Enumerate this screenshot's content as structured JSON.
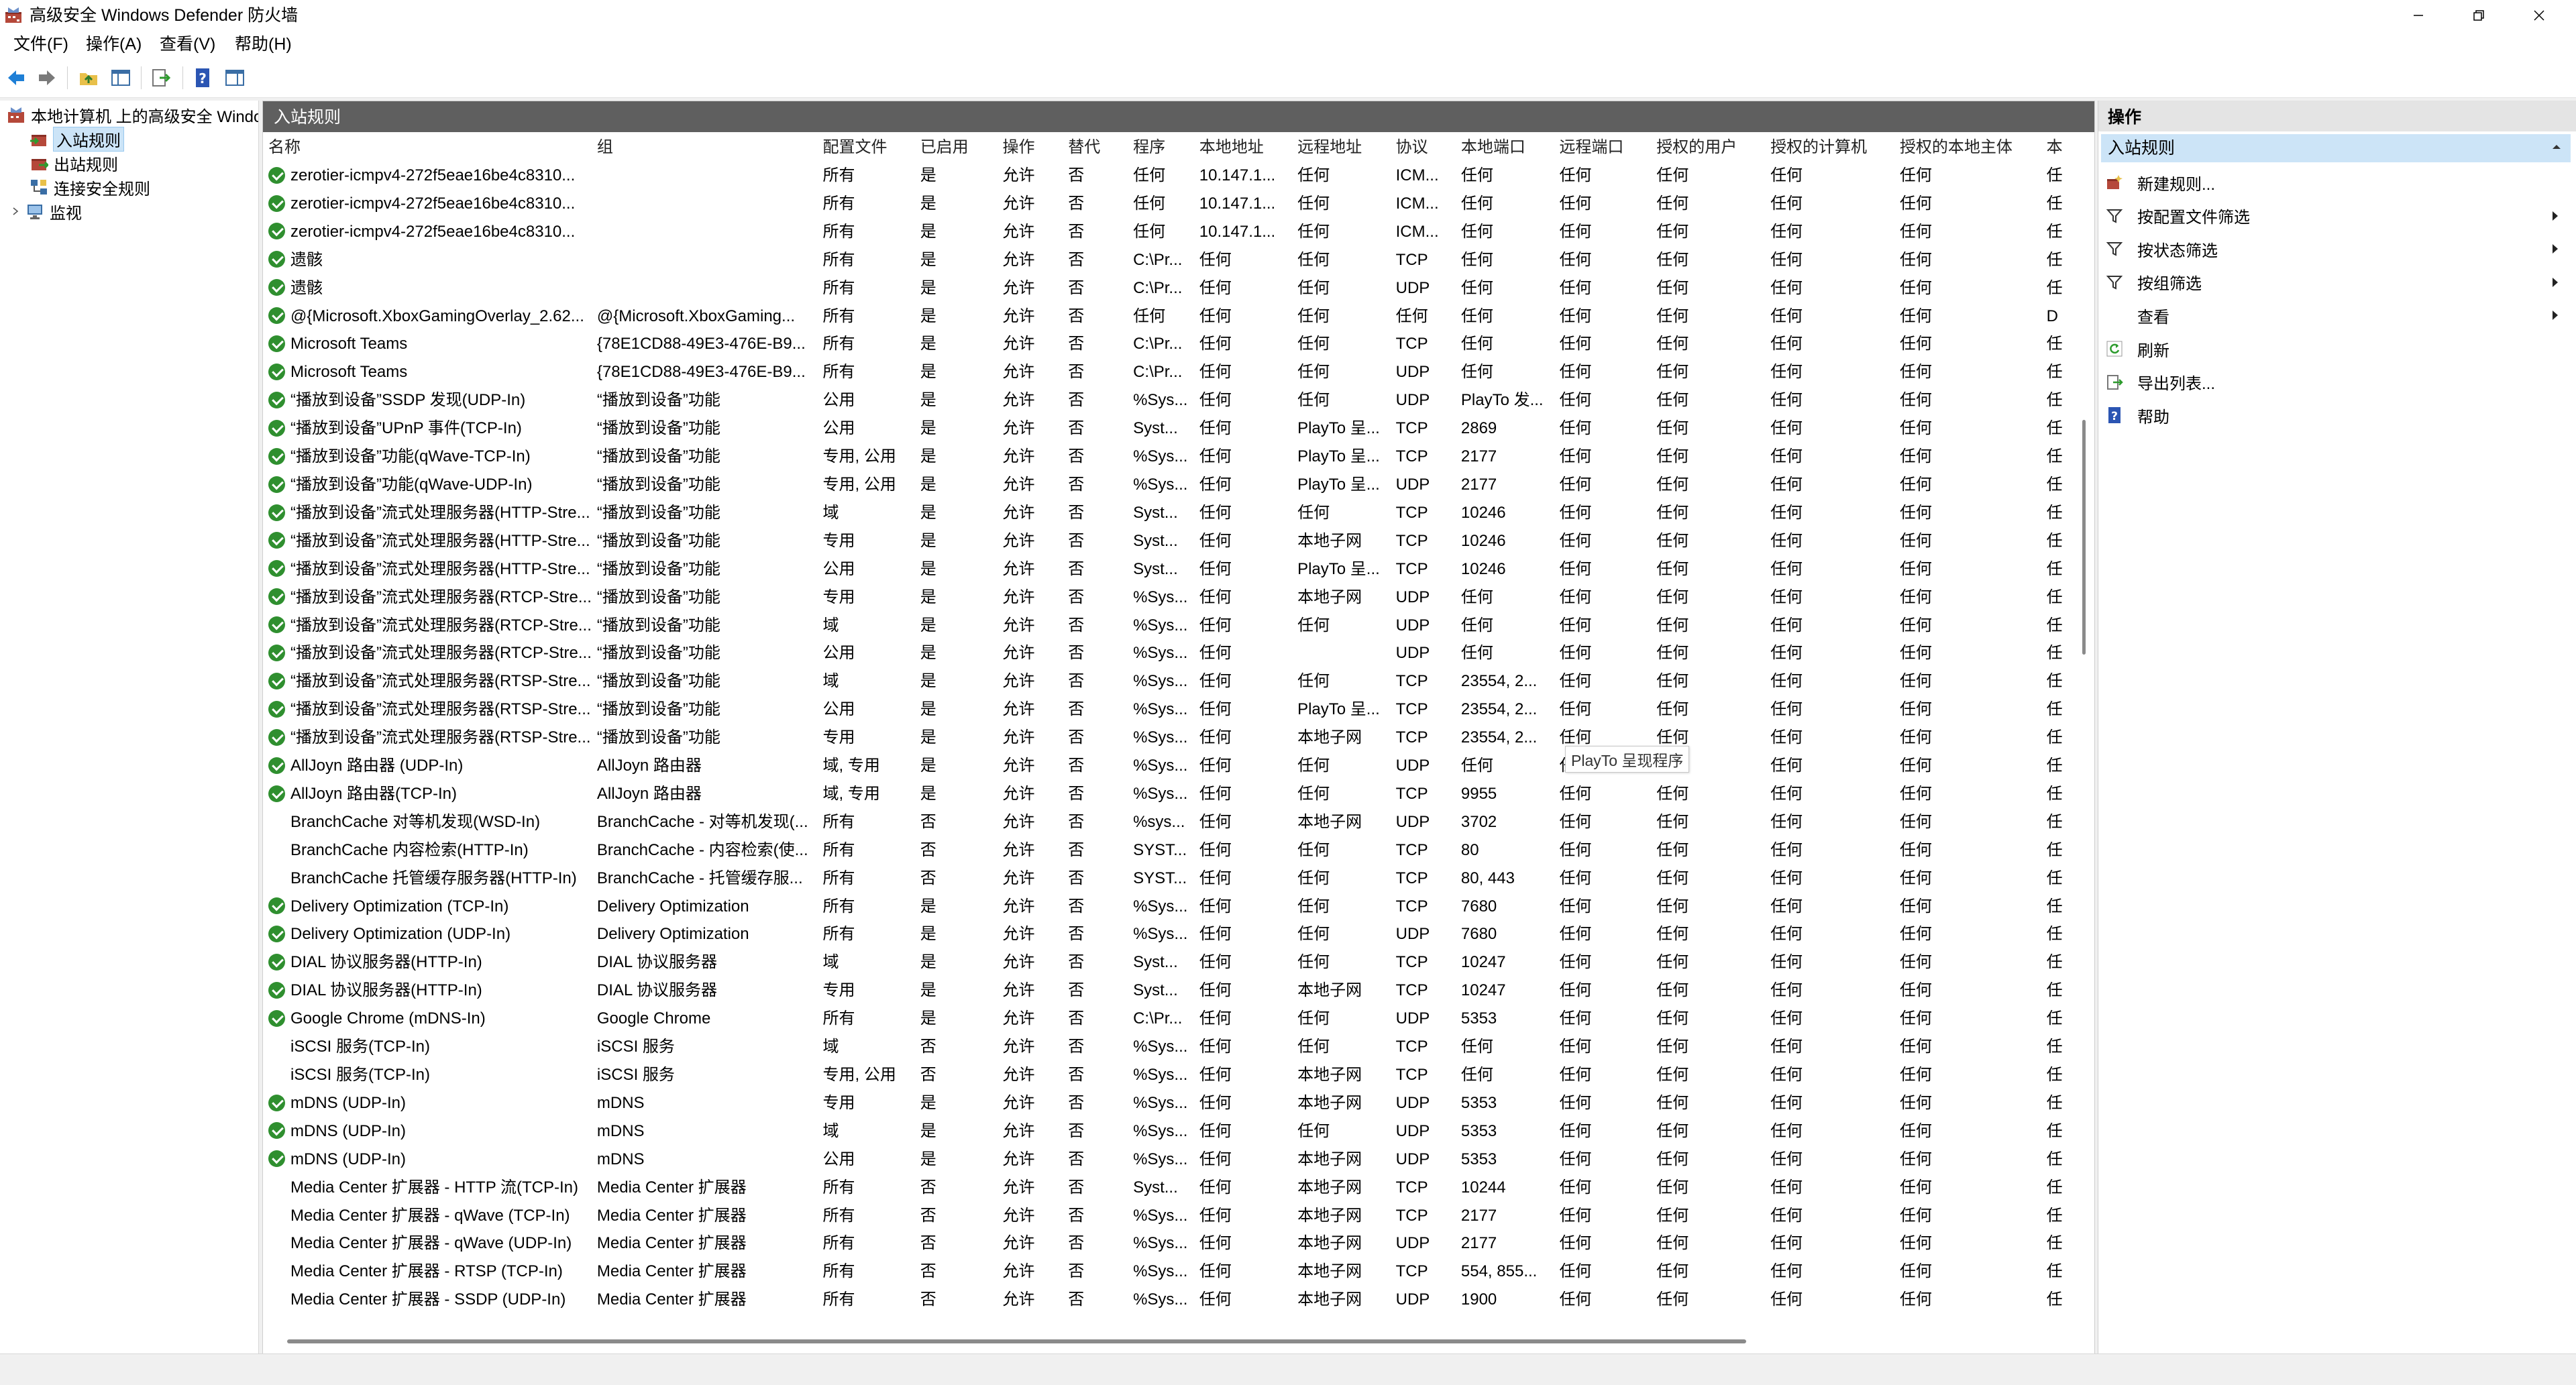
{
  "window": {
    "title": "高级安全 Windows Defender 防火墙",
    "controls": [
      "minimize-icon",
      "maximize-icon",
      "close-icon"
    ]
  },
  "menu": [
    "文件(F)",
    "操作(A)",
    "查看(V)",
    "帮助(H)"
  ],
  "toolbar": [
    "back-icon",
    "forward-icon",
    "up-folder-icon",
    "show-hide-tree-icon",
    "export-icon",
    "help-icon",
    "properties-pane-icon"
  ],
  "tree": {
    "root": "本地计算机 上的高级安全 Windows Defender 防火墙",
    "items": [
      "入站规则",
      "出站规则",
      "连接安全规则",
      "监视"
    ],
    "selected": "入站规则"
  },
  "center": {
    "title": "入站规则",
    "columns": [
      "名称",
      "组",
      "配置文件",
      "已启用",
      "操作",
      "替代",
      "程序",
      "本地地址",
      "远程地址",
      "协议",
      "本地端口",
      "远程端口",
      "授权的用户",
      "授权的计算机",
      "授权的本地主体",
      "本"
    ],
    "rows": [
      {
        "on": true,
        "c": [
          "zerotier-icmpv4-272f5eae16be4c8310...",
          "",
          "所有",
          "是",
          "允许",
          "否",
          "任何",
          "10.147.1...",
          "任何",
          "ICM...",
          "任何",
          "任何",
          "任何",
          "任何",
          "任何",
          "任"
        ]
      },
      {
        "on": true,
        "c": [
          "zerotier-icmpv4-272f5eae16be4c8310...",
          "",
          "所有",
          "是",
          "允许",
          "否",
          "任何",
          "10.147.1...",
          "任何",
          "ICM...",
          "任何",
          "任何",
          "任何",
          "任何",
          "任何",
          "任"
        ]
      },
      {
        "on": true,
        "c": [
          "zerotier-icmpv4-272f5eae16be4c8310...",
          "",
          "所有",
          "是",
          "允许",
          "否",
          "任何",
          "10.147.1...",
          "任何",
          "ICM...",
          "任何",
          "任何",
          "任何",
          "任何",
          "任何",
          "任"
        ]
      },
      {
        "on": true,
        "c": [
          "遗骸",
          "",
          "所有",
          "是",
          "允许",
          "否",
          "C:\\Pr...",
          "任何",
          "任何",
          "TCP",
          "任何",
          "任何",
          "任何",
          "任何",
          "任何",
          "任"
        ]
      },
      {
        "on": true,
        "c": [
          "遗骸",
          "",
          "所有",
          "是",
          "允许",
          "否",
          "C:\\Pr...",
          "任何",
          "任何",
          "UDP",
          "任何",
          "任何",
          "任何",
          "任何",
          "任何",
          "任"
        ]
      },
      {
        "on": true,
        "c": [
          "@{Microsoft.XboxGamingOverlay_2.62...",
          "@{Microsoft.XboxGaming...",
          "所有",
          "是",
          "允许",
          "否",
          "任何",
          "任何",
          "任何",
          "任何",
          "任何",
          "任何",
          "任何",
          "任何",
          "任何",
          "D"
        ]
      },
      {
        "on": true,
        "c": [
          "Microsoft Teams",
          "{78E1CD88-49E3-476E-B9...",
          "所有",
          "是",
          "允许",
          "否",
          "C:\\Pr...",
          "任何",
          "任何",
          "TCP",
          "任何",
          "任何",
          "任何",
          "任何",
          "任何",
          "任"
        ]
      },
      {
        "on": true,
        "c": [
          "Microsoft Teams",
          "{78E1CD88-49E3-476E-B9...",
          "所有",
          "是",
          "允许",
          "否",
          "C:\\Pr...",
          "任何",
          "任何",
          "UDP",
          "任何",
          "任何",
          "任何",
          "任何",
          "任何",
          "任"
        ]
      },
      {
        "on": true,
        "c": [
          "“播放到设备”SSDP 发现(UDP-In)",
          "“播放到设备”功能",
          "公用",
          "是",
          "允许",
          "否",
          "%Sys...",
          "任何",
          "任何",
          "UDP",
          "PlayTo 发...",
          "任何",
          "任何",
          "任何",
          "任何",
          "任"
        ]
      },
      {
        "on": true,
        "c": [
          "“播放到设备”UPnP 事件(TCP-In)",
          "“播放到设备”功能",
          "公用",
          "是",
          "允许",
          "否",
          "Syst...",
          "任何",
          "PlayTo 呈...",
          "TCP",
          "2869",
          "任何",
          "任何",
          "任何",
          "任何",
          "任"
        ]
      },
      {
        "on": true,
        "c": [
          "“播放到设备”功能(qWave-TCP-In)",
          "“播放到设备”功能",
          "专用, 公用",
          "是",
          "允许",
          "否",
          "%Sys...",
          "任何",
          "PlayTo 呈...",
          "TCP",
          "2177",
          "任何",
          "任何",
          "任何",
          "任何",
          "任"
        ]
      },
      {
        "on": true,
        "c": [
          "“播放到设备”功能(qWave-UDP-In)",
          "“播放到设备”功能",
          "专用, 公用",
          "是",
          "允许",
          "否",
          "%Sys...",
          "任何",
          "PlayTo 呈...",
          "UDP",
          "2177",
          "任何",
          "任何",
          "任何",
          "任何",
          "任"
        ]
      },
      {
        "on": true,
        "c": [
          "“播放到设备”流式处理服务器(HTTP-Stre...",
          "“播放到设备”功能",
          "域",
          "是",
          "允许",
          "否",
          "Syst...",
          "任何",
          "任何",
          "TCP",
          "10246",
          "任何",
          "任何",
          "任何",
          "任何",
          "任"
        ]
      },
      {
        "on": true,
        "c": [
          "“播放到设备”流式处理服务器(HTTP-Stre...",
          "“播放到设备”功能",
          "专用",
          "是",
          "允许",
          "否",
          "Syst...",
          "任何",
          "本地子网",
          "TCP",
          "10246",
          "任何",
          "任何",
          "任何",
          "任何",
          "任"
        ]
      },
      {
        "on": true,
        "c": [
          "“播放到设备”流式处理服务器(HTTP-Stre...",
          "“播放到设备”功能",
          "公用",
          "是",
          "允许",
          "否",
          "Syst...",
          "任何",
          "PlayTo 呈...",
          "TCP",
          "10246",
          "任何",
          "任何",
          "任何",
          "任何",
          "任"
        ]
      },
      {
        "on": true,
        "c": [
          "“播放到设备”流式处理服务器(RTCP-Stre...",
          "“播放到设备”功能",
          "专用",
          "是",
          "允许",
          "否",
          "%Sys...",
          "任何",
          "本地子网",
          "UDP",
          "任何",
          "任何",
          "任何",
          "任何",
          "任何",
          "任"
        ]
      },
      {
        "on": true,
        "c": [
          "“播放到设备”流式处理服务器(RTCP-Stre...",
          "“播放到设备”功能",
          "域",
          "是",
          "允许",
          "否",
          "%Sys...",
          "任何",
          "任何",
          "UDP",
          "任何",
          "任何",
          "任何",
          "任何",
          "任何",
          "任"
        ]
      },
      {
        "on": true,
        "c": [
          "“播放到设备”流式处理服务器(RTCP-Stre...",
          "“播放到设备”功能",
          "公用",
          "是",
          "允许",
          "否",
          "%Sys...",
          "任何",
          "",
          "UDP",
          "任何",
          "任何",
          "任何",
          "任何",
          "任何",
          "任"
        ]
      },
      {
        "on": true,
        "c": [
          "“播放到设备”流式处理服务器(RTSP-Stre...",
          "“播放到设备”功能",
          "域",
          "是",
          "允许",
          "否",
          "%Sys...",
          "任何",
          "任何",
          "TCP",
          "23554, 2...",
          "任何",
          "任何",
          "任何",
          "任何",
          "任"
        ]
      },
      {
        "on": true,
        "c": [
          "“播放到设备”流式处理服务器(RTSP-Stre...",
          "“播放到设备”功能",
          "公用",
          "是",
          "允许",
          "否",
          "%Sys...",
          "任何",
          "PlayTo 呈...",
          "TCP",
          "23554, 2...",
          "任何",
          "任何",
          "任何",
          "任何",
          "任"
        ]
      },
      {
        "on": true,
        "c": [
          "“播放到设备”流式处理服务器(RTSP-Stre...",
          "“播放到设备”功能",
          "专用",
          "是",
          "允许",
          "否",
          "%Sys...",
          "任何",
          "本地子网",
          "TCP",
          "23554, 2...",
          "任何",
          "任何",
          "任何",
          "任何",
          "任"
        ]
      },
      {
        "on": true,
        "c": [
          "AllJoyn 路由器 (UDP-In)",
          "AllJoyn 路由器",
          "域, 专用",
          "是",
          "允许",
          "否",
          "%Sys...",
          "任何",
          "任何",
          "UDP",
          "任何",
          "任何",
          "任何",
          "任何",
          "任何",
          "任"
        ]
      },
      {
        "on": true,
        "c": [
          "AllJoyn 路由器(TCP-In)",
          "AllJoyn 路由器",
          "域, 专用",
          "是",
          "允许",
          "否",
          "%Sys...",
          "任何",
          "任何",
          "TCP",
          "9955",
          "任何",
          "任何",
          "任何",
          "任何",
          "任"
        ]
      },
      {
        "on": false,
        "c": [
          "BranchCache 对等机发现(WSD-In)",
          "BranchCache - 对等机发现(...",
          "所有",
          "否",
          "允许",
          "否",
          "%sys...",
          "任何",
          "本地子网",
          "UDP",
          "3702",
          "任何",
          "任何",
          "任何",
          "任何",
          "任"
        ]
      },
      {
        "on": false,
        "c": [
          "BranchCache 内容检索(HTTP-In)",
          "BranchCache - 内容检索(使...",
          "所有",
          "否",
          "允许",
          "否",
          "SYST...",
          "任何",
          "任何",
          "TCP",
          "80",
          "任何",
          "任何",
          "任何",
          "任何",
          "任"
        ]
      },
      {
        "on": false,
        "c": [
          "BranchCache 托管缓存服务器(HTTP-In)",
          "BranchCache - 托管缓存服...",
          "所有",
          "否",
          "允许",
          "否",
          "SYST...",
          "任何",
          "任何",
          "TCP",
          "80, 443",
          "任何",
          "任何",
          "任何",
          "任何",
          "任"
        ]
      },
      {
        "on": true,
        "c": [
          "Delivery Optimization (TCP-In)",
          "Delivery Optimization",
          "所有",
          "是",
          "允许",
          "否",
          "%Sys...",
          "任何",
          "任何",
          "TCP",
          "7680",
          "任何",
          "任何",
          "任何",
          "任何",
          "任"
        ]
      },
      {
        "on": true,
        "c": [
          "Delivery Optimization (UDP-In)",
          "Delivery Optimization",
          "所有",
          "是",
          "允许",
          "否",
          "%Sys...",
          "任何",
          "任何",
          "UDP",
          "7680",
          "任何",
          "任何",
          "任何",
          "任何",
          "任"
        ]
      },
      {
        "on": true,
        "c": [
          "DIAL 协议服务器(HTTP-In)",
          "DIAL 协议服务器",
          "域",
          "是",
          "允许",
          "否",
          "Syst...",
          "任何",
          "任何",
          "TCP",
          "10247",
          "任何",
          "任何",
          "任何",
          "任何",
          "任"
        ]
      },
      {
        "on": true,
        "c": [
          "DIAL 协议服务器(HTTP-In)",
          "DIAL 协议服务器",
          "专用",
          "是",
          "允许",
          "否",
          "Syst...",
          "任何",
          "本地子网",
          "TCP",
          "10247",
          "任何",
          "任何",
          "任何",
          "任何",
          "任"
        ]
      },
      {
        "on": true,
        "c": [
          "Google Chrome (mDNS-In)",
          "Google Chrome",
          "所有",
          "是",
          "允许",
          "否",
          "C:\\Pr...",
          "任何",
          "任何",
          "UDP",
          "5353",
          "任何",
          "任何",
          "任何",
          "任何",
          "任"
        ]
      },
      {
        "on": false,
        "c": [
          "iSCSI 服务(TCP-In)",
          "iSCSI 服务",
          "域",
          "否",
          "允许",
          "否",
          "%Sys...",
          "任何",
          "任何",
          "TCP",
          "任何",
          "任何",
          "任何",
          "任何",
          "任何",
          "任"
        ]
      },
      {
        "on": false,
        "c": [
          "iSCSI 服务(TCP-In)",
          "iSCSI 服务",
          "专用, 公用",
          "否",
          "允许",
          "否",
          "%Sys...",
          "任何",
          "本地子网",
          "TCP",
          "任何",
          "任何",
          "任何",
          "任何",
          "任何",
          "任"
        ]
      },
      {
        "on": true,
        "c": [
          "mDNS (UDP-In)",
          "mDNS",
          "专用",
          "是",
          "允许",
          "否",
          "%Sys...",
          "任何",
          "本地子网",
          "UDP",
          "5353",
          "任何",
          "任何",
          "任何",
          "任何",
          "任"
        ]
      },
      {
        "on": true,
        "c": [
          "mDNS (UDP-In)",
          "mDNS",
          "域",
          "是",
          "允许",
          "否",
          "%Sys...",
          "任何",
          "任何",
          "UDP",
          "5353",
          "任何",
          "任何",
          "任何",
          "任何",
          "任"
        ]
      },
      {
        "on": true,
        "c": [
          "mDNS (UDP-In)",
          "mDNS",
          "公用",
          "是",
          "允许",
          "否",
          "%Sys...",
          "任何",
          "本地子网",
          "UDP",
          "5353",
          "任何",
          "任何",
          "任何",
          "任何",
          "任"
        ]
      },
      {
        "on": false,
        "c": [
          "Media Center 扩展器 - HTTP 流(TCP-In)",
          "Media Center 扩展器",
          "所有",
          "否",
          "允许",
          "否",
          "Syst...",
          "任何",
          "本地子网",
          "TCP",
          "10244",
          "任何",
          "任何",
          "任何",
          "任何",
          "任"
        ]
      },
      {
        "on": false,
        "c": [
          "Media Center 扩展器 - qWave (TCP-In)",
          "Media Center 扩展器",
          "所有",
          "否",
          "允许",
          "否",
          "%Sys...",
          "任何",
          "本地子网",
          "TCP",
          "2177",
          "任何",
          "任何",
          "任何",
          "任何",
          "任"
        ]
      },
      {
        "on": false,
        "c": [
          "Media Center 扩展器 - qWave (UDP-In)",
          "Media Center 扩展器",
          "所有",
          "否",
          "允许",
          "否",
          "%Sys...",
          "任何",
          "本地子网",
          "UDP",
          "2177",
          "任何",
          "任何",
          "任何",
          "任何",
          "任"
        ]
      },
      {
        "on": false,
        "c": [
          "Media Center 扩展器 - RTSP (TCP-In)",
          "Media Center 扩展器",
          "所有",
          "否",
          "允许",
          "否",
          "%Sys...",
          "任何",
          "本地子网",
          "TCP",
          "554, 855...",
          "任何",
          "任何",
          "任何",
          "任何",
          "任"
        ]
      },
      {
        "on": false,
        "c": [
          "Media Center 扩展器 - SSDP (UDP-In)",
          "Media Center 扩展器",
          "所有",
          "否",
          "允许",
          "否",
          "%Sys...",
          "任何",
          "本地子网",
          "UDP",
          "1900",
          "任何",
          "任何",
          "任何",
          "任何",
          "任"
        ]
      }
    ],
    "tooltip": "PlayTo 呈现程序"
  },
  "actions": {
    "title": "操作",
    "section": "入站规则",
    "items": [
      {
        "label": "新建规则...",
        "icon": "new-rule-icon",
        "submenu": false
      },
      {
        "label": "按配置文件筛选",
        "icon": "filter-icon",
        "submenu": true
      },
      {
        "label": "按状态筛选",
        "icon": "filter-icon",
        "submenu": true
      },
      {
        "label": "按组筛选",
        "icon": "filter-icon",
        "submenu": true
      },
      {
        "label": "查看",
        "icon": "",
        "submenu": true
      },
      {
        "label": "刷新",
        "icon": "refresh-icon",
        "submenu": false
      },
      {
        "label": "导出列表...",
        "icon": "export-list-icon",
        "submenu": false
      },
      {
        "label": "帮助",
        "icon": "help-icon",
        "submenu": false
      }
    ]
  },
  "colors": {
    "header_dark": "#5f5f5f",
    "selection": "#cce4f7",
    "enabled_green": "#2f8f2f"
  }
}
